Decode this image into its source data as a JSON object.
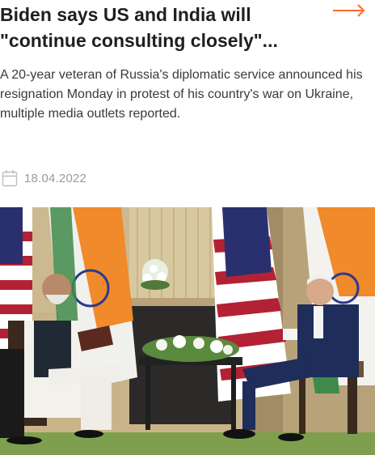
{
  "article": {
    "headline": "Biden says US and India will\n\"continue consulting closely\"...",
    "excerpt": "A 20-year veteran of Russia's diplomatic service announced his resignation Monday in protest of his country's war on Ukraine, multiple media outlets reported.",
    "date": "18.04.2022"
  },
  "icons": {
    "read_more": "arrow-right-icon",
    "date": "calendar-icon"
  },
  "colors": {
    "accent": "#ff6a2a",
    "headline": "#1f1f1f",
    "body_text": "#3a3a3a",
    "meta_text": "#9a9a9a"
  }
}
